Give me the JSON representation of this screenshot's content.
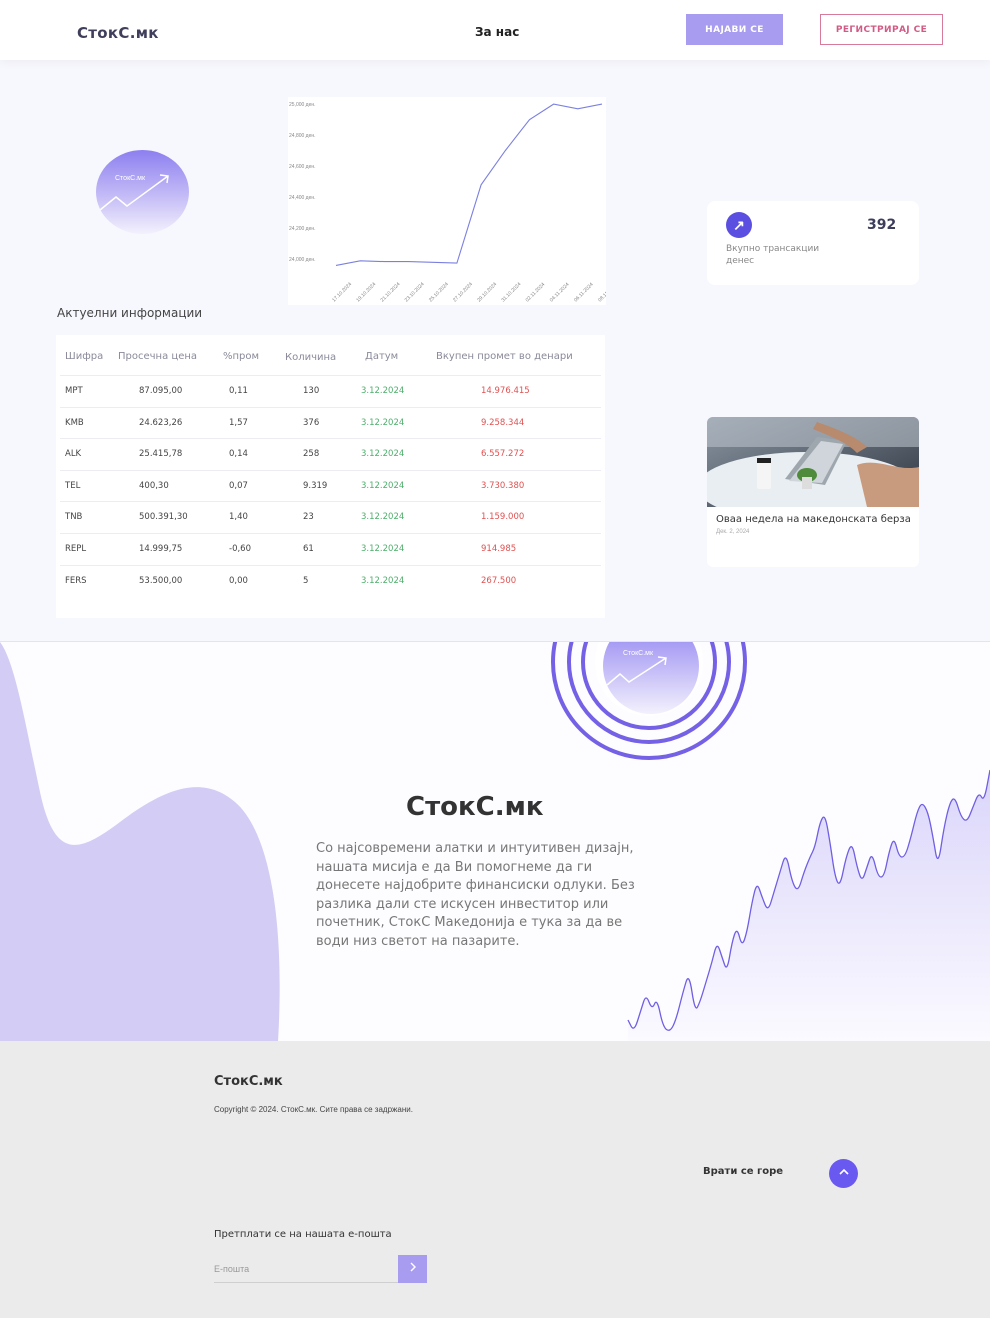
{
  "header": {
    "brand": "СтокС.мк",
    "nav_about": "За нас",
    "login_label": "НАЈАВИ СЕ",
    "register_label": "РЕГИСТРИРАЈ СЕ"
  },
  "logo": {
    "text": "СтокС.мк"
  },
  "chart_data": {
    "type": "line",
    "title": "",
    "xlabel": "",
    "ylabel": "",
    "x": [
      "17.10.2024",
      "19.10.2024",
      "21.10.2024",
      "23.10.2024",
      "25.10.2024",
      "27.10.2024",
      "29.10.2024",
      "31.10.2024",
      "02.11.2024",
      "04.11.2024",
      "06.11.2024",
      "08.11.2024"
    ],
    "series": [
      {
        "values": [
          23960,
          23990,
          23985,
          23985,
          23980,
          23975,
          24480,
          24700,
          24900,
          25000,
          24970,
          25000
        ]
      }
    ],
    "yticks": [
      "25,000 ден.",
      "24,800 ден.",
      "24,600 ден.",
      "24,400 ден.",
      "24,200 ден.",
      "24,000 ден."
    ],
    "ylim": [
      23950,
      25020
    ],
    "color": "#7b80e0",
    "grid": false
  },
  "table": {
    "section_title": "Актуелни информации",
    "headers": [
      "Шифра",
      "Просечна цена",
      "%пром",
      "Количина",
      "Датум",
      "Вкупен промет во денари"
    ],
    "rows": [
      [
        "MPT",
        "87.095,00",
        "0,11",
        "130",
        "3.12.2024",
        "14.976.415"
      ],
      [
        "KMB",
        "24.623,26",
        "1,57",
        "376",
        "3.12.2024",
        "9.258.344"
      ],
      [
        "ALK",
        "25.415,78",
        "0,14",
        "258",
        "3.12.2024",
        "6.557.272"
      ],
      [
        "TEL",
        "400,30",
        "0,07",
        "9.319",
        "3.12.2024",
        "3.730.380"
      ],
      [
        "TNB",
        "500.391,30",
        "1,40",
        "23",
        "3.12.2024",
        "1.159.000"
      ],
      [
        "REPL",
        "14.999,75",
        "-0,60",
        "61",
        "3.12.2024",
        "914.985"
      ],
      [
        "FERS",
        "53.500,00",
        "0,00",
        "5",
        "3.12.2024",
        "267.500"
      ]
    ]
  },
  "stats": {
    "value": "392",
    "label": "Вкупно трансакции денес",
    "icon": "arrow-up-right-icon"
  },
  "news": {
    "title": "Оваа недела на македонската берза",
    "date": "Дек. 2, 2024"
  },
  "about": {
    "title": "СтокС.мк",
    "logo_text": "СтокС.мк",
    "text": "Со најсовремени алатки и интуитивен дизајн, нашата мисија е да Ви помогнеме да ги донесете најдобрите финансиски одлуки. Без разлика дали сте искусен инвеститор или почетник, СтокС Македонија е тука за да ве води низ светот на пазарите."
  },
  "footer": {
    "brand": "СтокС.мк",
    "copyright": "Copyright © 2024. СтокС.мк. Сите права се задржани.",
    "back_to_top": "Врати се горе",
    "subscribe_label": "Претплати се на нашата е-пошта",
    "email_placeholder": "Е-пошта"
  },
  "colors": {
    "accent": "#6a59f0",
    "accent_light": "#a89cf0",
    "positive": "#4caf6a",
    "negative": "#e05151",
    "register_border": "#d87a9a"
  }
}
